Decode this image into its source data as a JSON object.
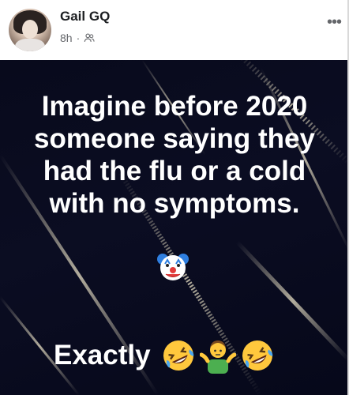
{
  "post": {
    "author": "Gail GQ",
    "time": "8h",
    "separator": "·",
    "audience_icon": "friends-icon",
    "more_label": "•••"
  },
  "meme": {
    "lines": [
      "Imagine before 2020",
      "someone saying they",
      "had the flu or a cold",
      "with no symptoms."
    ],
    "clown_emoji": "clown-face-icon",
    "exactly": "Exactly",
    "trailing_emojis": [
      "rolling-laughing-icon",
      "person-shrugging-icon",
      "rolling-laughing-icon"
    ]
  },
  "colors": {
    "background": "#0a0c20",
    "text": "#ffffff",
    "name": "#1c1e21",
    "meta": "#65676b"
  }
}
